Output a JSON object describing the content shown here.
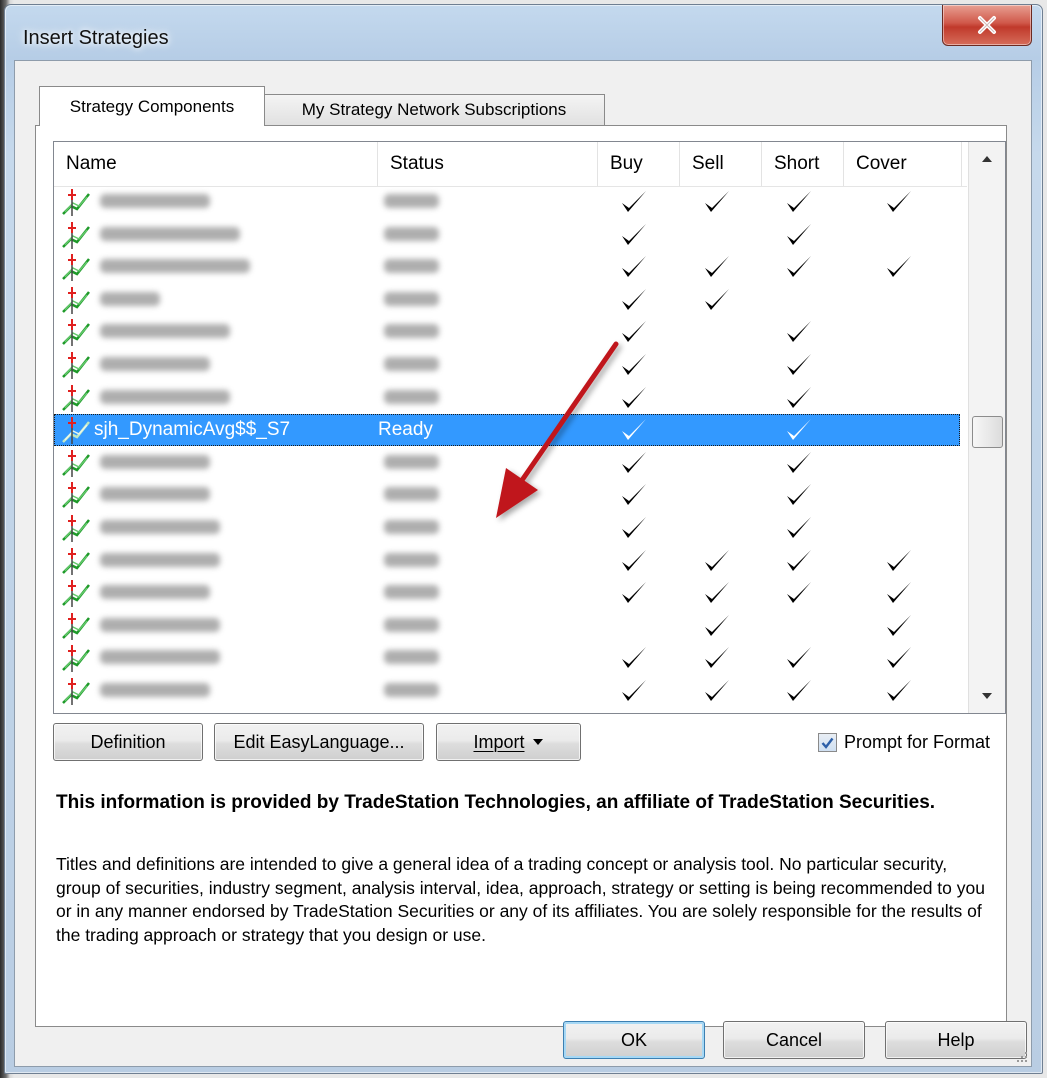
{
  "window": {
    "title": "Insert Strategies",
    "close_icon": "close-x-icon"
  },
  "tabs": [
    {
      "label": "Strategy Components",
      "active": true
    },
    {
      "label": "My Strategy Network Subscriptions",
      "active": false
    }
  ],
  "list": {
    "columns": [
      "Name",
      "Status",
      "Buy",
      "Sell",
      "Short",
      "Cover"
    ],
    "rows": [
      {
        "name": "",
        "status": "",
        "buy": true,
        "sell": true,
        "short": true,
        "cover": true,
        "obscured": true
      },
      {
        "name": "",
        "status": "",
        "buy": true,
        "sell": false,
        "short": true,
        "cover": false,
        "obscured": true
      },
      {
        "name": "",
        "status": "",
        "buy": true,
        "sell": true,
        "short": true,
        "cover": true,
        "obscured": true
      },
      {
        "name": "",
        "status": "",
        "buy": true,
        "sell": true,
        "short": false,
        "cover": false,
        "obscured": true
      },
      {
        "name": "",
        "status": "",
        "buy": true,
        "sell": false,
        "short": true,
        "cover": false,
        "obscured": true
      },
      {
        "name": "",
        "status": "",
        "buy": true,
        "sell": false,
        "short": true,
        "cover": false,
        "obscured": true
      },
      {
        "name": "",
        "status": "",
        "buy": true,
        "sell": false,
        "short": true,
        "cover": false,
        "obscured": true
      },
      {
        "name": "sjh_DynamicAvg$$_S7",
        "status": "Ready",
        "buy": true,
        "sell": false,
        "short": true,
        "cover": false,
        "obscured": false,
        "selected": true
      },
      {
        "name": "",
        "status": "",
        "buy": true,
        "sell": false,
        "short": true,
        "cover": false,
        "obscured": true
      },
      {
        "name": "",
        "status": "",
        "buy": true,
        "sell": false,
        "short": true,
        "cover": false,
        "obscured": true
      },
      {
        "name": "",
        "status": "",
        "buy": true,
        "sell": false,
        "short": true,
        "cover": false,
        "obscured": true
      },
      {
        "name": "",
        "status": "",
        "buy": true,
        "sell": true,
        "short": true,
        "cover": true,
        "obscured": true
      },
      {
        "name": "",
        "status": "",
        "buy": true,
        "sell": true,
        "short": true,
        "cover": true,
        "obscured": true
      },
      {
        "name": "",
        "status": "",
        "buy": false,
        "sell": true,
        "short": false,
        "cover": true,
        "obscured": true
      },
      {
        "name": "",
        "status": "",
        "buy": true,
        "sell": true,
        "short": true,
        "cover": true,
        "obscured": true
      },
      {
        "name": "",
        "status": "",
        "buy": true,
        "sell": true,
        "short": true,
        "cover": true,
        "obscured": true
      }
    ]
  },
  "buttons": {
    "definition": "Definition",
    "edit_easylanguage": "Edit EasyLanguage...",
    "import": "Import",
    "ok": "OK",
    "cancel": "Cancel",
    "help": "Help"
  },
  "prompt_for_format": {
    "label": "Prompt for Format",
    "checked": true
  },
  "info": {
    "heading": "This information is provided by TradeStation Technologies, an affiliate of TradeStation Securities.",
    "body": "Titles and definitions are intended to give a general idea of a trading concept or analysis tool. No particular security, group of securities, industry segment, analysis interval, idea, approach, strategy or setting is being recommended to you or in any manner endorsed by TradeStation Securities or any of its affiliates. You are solely responsible for the results of the trading approach or strategy that you design or use."
  },
  "colors": {
    "selection": "#3399ff",
    "annotation_arrow": "#c0141a",
    "strategy_icon_green": "#1f9a2a",
    "strategy_icon_red": "#e0201f"
  }
}
